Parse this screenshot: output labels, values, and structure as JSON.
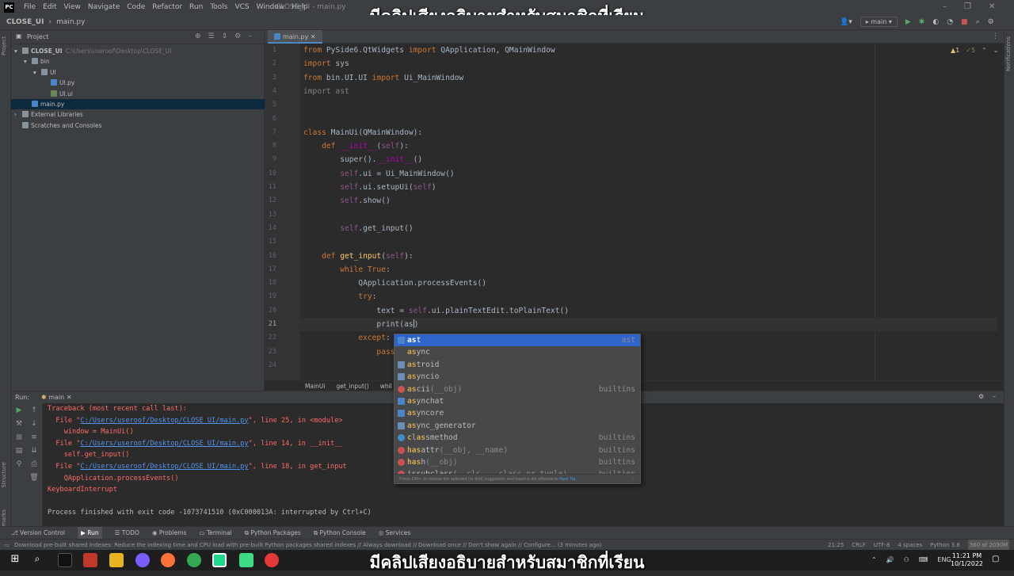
{
  "overlay": {
    "caption_top": "มีคลิปเสียงอธิบายสำหรับสมาชิกที่เรียน",
    "caption_bottom": "มีคลิปเสียงอธิบายสำหรับสมาชิกที่เรียน"
  },
  "titlebar": {
    "logo": "PC",
    "window_title": "CLOSE_UI - main.py",
    "menu": [
      "File",
      "Edit",
      "View",
      "Navigate",
      "Code",
      "Refactor",
      "Run",
      "Tools",
      "VCS",
      "Window",
      "Help"
    ]
  },
  "navbar": {
    "project": "CLOSE_UI",
    "file": "main.py",
    "run_config": "main"
  },
  "project_panel": {
    "title": "Project",
    "tree": [
      {
        "label": "CLOSE_UI",
        "hint": "C:\\Users\\useroof\\Desktop\\CLOSE_UI",
        "kind": "folder"
      },
      {
        "label": "bin",
        "kind": "folder"
      },
      {
        "label": "UI",
        "kind": "folder"
      },
      {
        "label": "UI.py",
        "kind": "py"
      },
      {
        "label": "UI.ui",
        "kind": "ui"
      },
      {
        "label": "main.py",
        "kind": "py"
      },
      {
        "label": "External Libraries",
        "kind": "folder"
      },
      {
        "label": "Scratches and Consoles",
        "kind": "folder"
      }
    ]
  },
  "editor": {
    "tab": "main.py",
    "warnings": "▲1",
    "checks": "✓5",
    "line_numbers": [
      "1",
      "2",
      "3",
      "4",
      "5",
      "6",
      "7",
      "8",
      "9",
      "10",
      "11",
      "12",
      "13",
      "14",
      "15",
      "16",
      "17",
      "18",
      "19",
      "20",
      "21",
      "22",
      "23",
      "24"
    ],
    "breadcrumb": [
      "MainUi",
      "get_input()",
      "whil"
    ]
  },
  "autocomplete": {
    "items": [
      {
        "match": "as",
        "rest": "t",
        "sig": "",
        "tail": "ast",
        "icon": "module-icon",
        "selected": true
      },
      {
        "match": "as",
        "rest": "ync",
        "sig": "",
        "tail": "",
        "icon": "none",
        "selected": false
      },
      {
        "match": "as",
        "rest": "troid",
        "sig": "",
        "tail": "",
        "icon": "package-icon",
        "selected": false
      },
      {
        "match": "as",
        "rest": "yncio",
        "sig": "",
        "tail": "",
        "icon": "package-icon",
        "selected": false
      },
      {
        "match": "as",
        "rest": "cii",
        "sig": "(__obj)",
        "tail": "builtins",
        "icon": "function-icon",
        "selected": false
      },
      {
        "match": "as",
        "rest": "ynchat",
        "sig": "",
        "tail": "",
        "icon": "module-icon",
        "selected": false
      },
      {
        "match": "as",
        "rest": "yncore",
        "sig": "",
        "tail": "",
        "icon": "module-icon",
        "selected": false
      },
      {
        "match": "as",
        "rest": "ync_generator",
        "sig": "",
        "tail": "",
        "icon": "package-icon",
        "selected": false
      },
      {
        "match": "c",
        "rest": "l",
        "extra_match": "as",
        "extra_rest": "smethod",
        "sig": "",
        "tail": "builtins",
        "icon": "class-icon",
        "selected": false
      },
      {
        "match": "h",
        "rest": "",
        "extra_match": "as",
        "extra_rest": "attr",
        "sig": "(__obj, __name)",
        "tail": "builtins",
        "icon": "function-icon",
        "selected": false
      },
      {
        "match": "h",
        "rest": "",
        "extra_match": "as",
        "extra_rest": "h",
        "sig": "(__obj)",
        "tail": "builtins",
        "icon": "function-icon",
        "selected": false
      },
      {
        "match": "",
        "rest": "issubclass",
        "sig": "(__cls, __class_or_tuple)",
        "tail": "builtins",
        "icon": "function-icon",
        "selected": false
      }
    ],
    "footer": "Press Ctrl+. to choose the selected (or first) suggestion and insert a dot afterwards",
    "next_tip": "Next Tip"
  },
  "run_panel": {
    "label": "Run:",
    "config": "main"
  },
  "console": {
    "lines": [
      {
        "t": "err",
        "text": "Traceback (most recent call last):"
      },
      {
        "t": "file",
        "pre": "  File \"",
        "link": "C:/Users/useroof/Desktop/CLOSE_UI/main.py",
        "post": "\", line 25, in <module>"
      },
      {
        "t": "err",
        "text": "    window = MainUi()"
      },
      {
        "t": "file",
        "pre": "  File \"",
        "link": "C:/Users/useroof/Desktop/CLOSE_UI/main.py",
        "post": "\", line 14, in __init__"
      },
      {
        "t": "err",
        "text": "    self.get_input()"
      },
      {
        "t": "file",
        "pre": "  File \"",
        "link": "C:/Users/useroof/Desktop/CLOSE_UI/main.py",
        "post": "\", line 18, in get_input"
      },
      {
        "t": "err",
        "text": "    QApplication.processEvents()"
      },
      {
        "t": "err",
        "text": "KeyboardInterrupt"
      },
      {
        "t": "blank",
        "text": ""
      },
      {
        "t": "norm",
        "text": "Process finished with exit code -1073741510 (0xC000013A: interrupted by Ctrl+C)"
      }
    ]
  },
  "bottom_tabs": [
    "Version Control",
    "Run",
    "TODO",
    "Problems",
    "Terminal",
    "Python Packages",
    "Python Console",
    "Services"
  ],
  "status": {
    "message": "Download pre-built shared indexes: Reduce the indexing time and CPU load with pre-built Python packages shared indexes // Always download // Download once // Don't show again // Configure... (3 minutes ago)",
    "position": "21:25",
    "line_sep": "CRLF",
    "encoding": "UTF-8",
    "indent": "4 spaces",
    "interpreter": "Python 3.8",
    "memory": "360 of 2030M"
  },
  "taskbar": {
    "time": "11:21 PM",
    "date": "10/1/2022",
    "lang": "ENG"
  }
}
